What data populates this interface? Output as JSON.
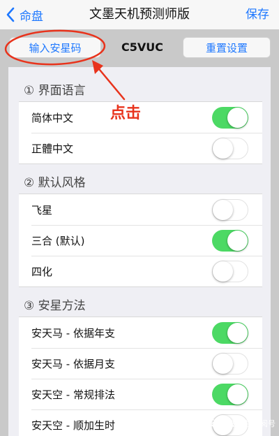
{
  "nav": {
    "back_label": "命盘",
    "title": "文墨天机预测师版",
    "save_label": "保存"
  },
  "toolbar": {
    "input_label": "输入安星码",
    "code": "C5VUC",
    "reset_label": "重置设置"
  },
  "callout": "点击",
  "colors": {
    "accent": "#1e78ff",
    "switch_on": "#4cd964",
    "annotation": "#e8331c"
  },
  "sections": [
    {
      "header": "① 界面语言",
      "rows": [
        {
          "label": "简体中文",
          "on": true
        },
        {
          "label": "正體中文",
          "on": false
        }
      ]
    },
    {
      "header": "② 默认风格",
      "rows": [
        {
          "label": "飞星",
          "on": false
        },
        {
          "label": "三合 (默认)",
          "on": true
        },
        {
          "label": "四化",
          "on": false
        }
      ]
    },
    {
      "header": "③ 安星方法",
      "rows": [
        {
          "label": "安天马 - 依据年支",
          "on": true
        },
        {
          "label": "安天马 - 依据月支",
          "on": false
        },
        {
          "label": "安天空 - 常规排法",
          "on": true
        },
        {
          "label": "安天空 - 顺加生时",
          "on": false
        }
      ]
    }
  ],
  "watermark": "文墨天机订阅号"
}
